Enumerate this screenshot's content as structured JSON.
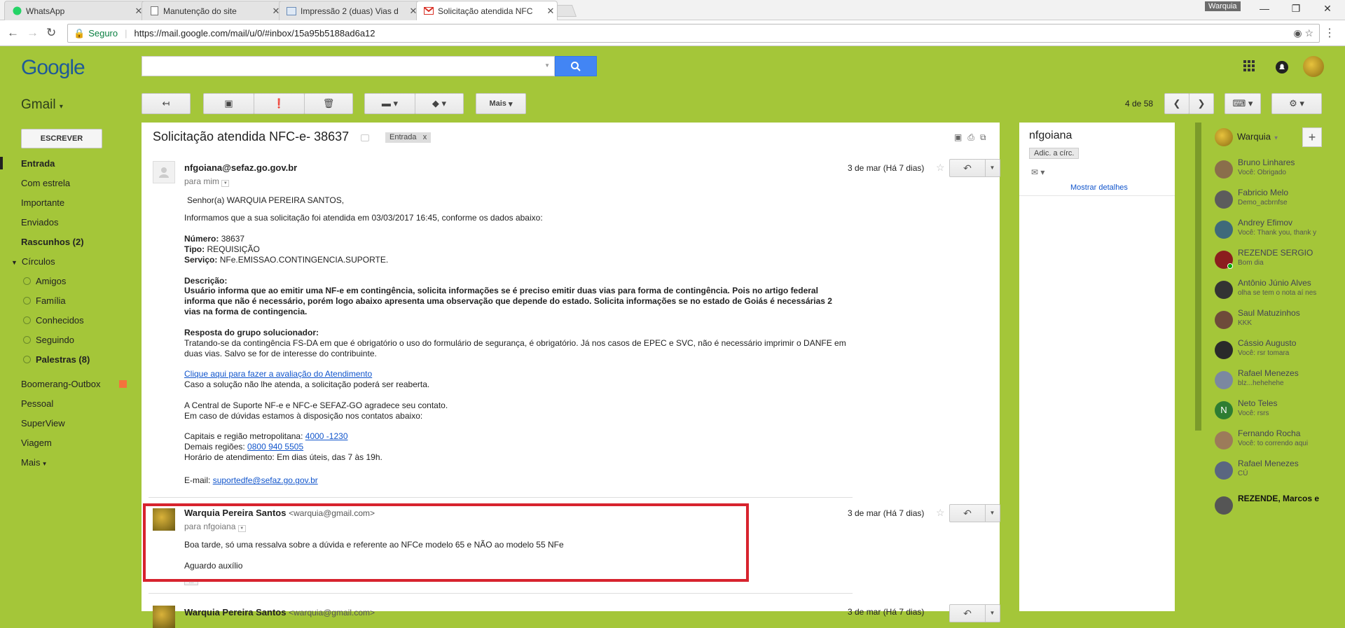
{
  "browser": {
    "tabs": [
      {
        "title": "WhatsApp",
        "icon": "whatsapp-icon"
      },
      {
        "title": "Manutenção do site",
        "icon": "document-icon"
      },
      {
        "title": "Impressão 2 (duas) Vias d",
        "icon": "image-icon"
      },
      {
        "title": "Solicitação atendida NFC",
        "icon": "gmail-icon"
      }
    ],
    "profile_user": "Warquia",
    "security_label": "Seguro",
    "url": "https://mail.google.com/mail/u/0/#inbox/15a95b5188ad6a12"
  },
  "header": {
    "logo": "Google",
    "app_name": "Gmail"
  },
  "toolbar": {
    "more_label": "Mais",
    "pager": "4 de 58"
  },
  "nav": {
    "compose": "ESCREVER",
    "items": [
      "Entrada",
      "Com estrela",
      "Importante",
      "Enviados",
      "Rascunhos (2)",
      "Círculos"
    ],
    "circles": [
      "Amigos",
      "Família",
      "Conhecidos",
      "Seguindo",
      "Palestras (8)"
    ],
    "labels": [
      "Boomerang-Outbox",
      "Pessoal",
      "SuperView",
      "Viagem",
      "Mais"
    ]
  },
  "thread": {
    "subject": "Solicitação atendida NFC-e- 38637",
    "label": "Entrada",
    "label_close": "x",
    "messages": [
      {
        "sender": "nfgoiana@sefaz.go.gov.br",
        "to": "para mim",
        "date": "3 de mar (Há 7 dias)",
        "greeting": "Senhor(a) WARQUIA PEREIRA SANTOS,",
        "intro": "Informamos que a sua solicitação foi atendida em 03/03/2017 16:45, conforme os dados abaixo:",
        "numero_label": "Número:",
        "numero": "38637",
        "tipo_label": "Tipo:",
        "tipo": "REQUISIÇÃO",
        "servico_label": "Serviço:",
        "servico": "NFe.EMISSAO.CONTINGENCIA.SUPORTE.",
        "descricao_label": "Descrição:",
        "descricao": "Usuário informa que ao emitir uma NF-e em contingência, solicita informações se é preciso emitir duas vias para forma de contingência. Pois no artigo federal informa que não é necessário, porém logo abaixo apresenta uma observação que depende do estado. Solicita informações se no estado de Goiás é necessárias 2 vias na forma de contingencia.",
        "resposta_label": "Resposta do grupo solucionador:",
        "resposta": "Tratando-se da contingência FS-DA em que é obrigatório o uso do formulário de segurança, é obrigatório. Já nos casos de EPEC e SVC, não é necessário imprimir o DANFE em duas vias. Salvo se for de interesse do contribuinte.",
        "link": "Clique aqui para fazer a avaliação do Atendimento",
        "reopen": "Caso a solução não lhe atenda, a solicitação poderá ser reaberta.",
        "thanks": "A Central de Suporte NF-e e NFC-e SEFAZ-GO agradece seu contato.",
        "doubts": "Em caso de dúvidas estamos à disposição nos contatos abaixo:",
        "capitais_label": "Capitais e região metropolitana:",
        "capitais": "4000 -1230",
        "demais_label": "Demais regiões:",
        "demais": "0800 940 5505",
        "horario": "Horário de atendimento: Em dias úteis, das 7 às 19h.",
        "email_label": "E-mail:",
        "email": "suportedfe@sefaz.go.gov.br"
      },
      {
        "sender": "Warquia Pereira Santos",
        "sender_email": "<warquia@gmail.com>",
        "to": "para nfgoiana",
        "date": "3 de mar (Há 7 dias)",
        "line1": "Boa tarde, só uma ressalva sobre a dúvida e referente ao NFCe modelo 65 e NÃO ao modelo 55 NFe",
        "line2": "Aguardo auxílio"
      },
      {
        "sender": "Warquia Pereira Santos",
        "sender_email": "<warquia@gmail.com>",
        "date": "3 de mar (Há 7 dias)"
      }
    ]
  },
  "contact": {
    "name": "nfgoiana",
    "add_label": "Adic. a círc.",
    "details_label": "Mostrar detalhes"
  },
  "chat": {
    "me": "Warquia",
    "contacts": [
      {
        "name": "Bruno Linhares",
        "status": "Você: Obrigado"
      },
      {
        "name": "Fabricio Melo",
        "status": "Demo_acbrnfse"
      },
      {
        "name": "Andrey Efimov",
        "status": "Você: Thank you, thank y"
      },
      {
        "name": "REZENDE SERGIO",
        "status": "Bom dia"
      },
      {
        "name": "Antônio Júnio Alves",
        "status": "olha se tem o nota aí nes"
      },
      {
        "name": "Saul Matuzinhos",
        "status": "KKK"
      },
      {
        "name": "Cássio Augusto",
        "status": "Você: rsr tomara"
      },
      {
        "name": "Rafael Menezes",
        "status": "blz...hehehehe"
      },
      {
        "name": "Neto Teles",
        "status": "Você: rsrs"
      },
      {
        "name": "Fernando Rocha",
        "status": "Você: to correndo aqui"
      },
      {
        "name": "Rafael Menezes",
        "status": "CÚ"
      },
      {
        "name": "REZENDE, Marcos e",
        "status": ""
      }
    ]
  },
  "colors": {
    "gmail_theme": "#a4c639",
    "search_button": "#4285f4",
    "highlight": "#d7232e"
  }
}
